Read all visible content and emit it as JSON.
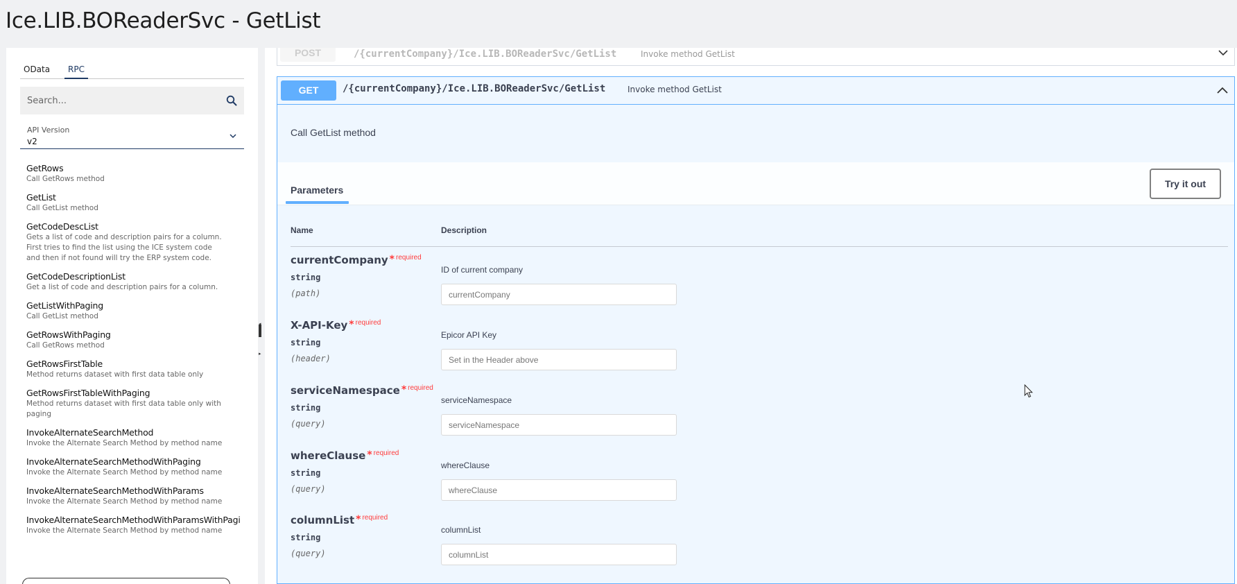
{
  "page": {
    "title": "Ice.LIB.BOReaderSvc - GetList"
  },
  "sidebar": {
    "tabs": [
      {
        "label": "OData"
      },
      {
        "label": "RPC"
      }
    ],
    "search": {
      "placeholder": "Search..."
    },
    "api_version": {
      "label": "API Version",
      "value": "v2"
    },
    "methods": [
      {
        "name": "GetRows",
        "description": "Call GetRows method"
      },
      {
        "name": "GetList",
        "description": "Call GetList method"
      },
      {
        "name": "GetCodeDescList",
        "description": "Gets a list of code and description pairs for a column. First tries to find the list using the ICE system code and then if not found will try the ERP system code."
      },
      {
        "name": "GetCodeDescriptionList",
        "description": "Get a list of code and description pairs for a column."
      },
      {
        "name": "GetListWithPaging",
        "description": "Call GetList method"
      },
      {
        "name": "GetRowsWithPaging",
        "description": "Call GetRows method"
      },
      {
        "name": "GetRowsFirstTable",
        "description": "Method returns dataset with first data table only"
      },
      {
        "name": "GetRowsFirstTableWithPaging",
        "description": "Method returns dataset with first data table only with paging"
      },
      {
        "name": "InvokeAlternateSearchMethod",
        "description": "Invoke the Alternate Search Method by method name"
      },
      {
        "name": "InvokeAlternateSearchMethodWithPaging",
        "description": "Invoke the Alternate Search Method by method name"
      },
      {
        "name": "InvokeAlternateSearchMethodWithParams",
        "description": "Invoke the Alternate Search Method by method name"
      },
      {
        "name": "InvokeAlternateSearchMethodWithParamsWithPagi",
        "description": "Invoke the Alternate Search Method by method name"
      }
    ]
  },
  "operations": {
    "post": {
      "method": "POST",
      "path": "/{currentCompany}/Ice.LIB.BOReaderSvc/GetList",
      "summary": "Invoke method GetList"
    },
    "get": {
      "method": "GET",
      "path": "/{currentCompany}/Ice.LIB.BOReaderSvc/GetList",
      "summary": "Invoke method GetList",
      "description": "Call GetList method",
      "parameters_tab": "Parameters",
      "try_button": "Try it out",
      "columns": {
        "name": "Name",
        "description": "Description"
      },
      "required_label": "required",
      "required_star": "*",
      "params": [
        {
          "name": "currentCompany",
          "type": "string",
          "in": "(path)",
          "description": "ID of current company",
          "placeholder": "currentCompany"
        },
        {
          "name": "X-API-Key",
          "type": "string",
          "in": "(header)",
          "description": "Epicor API Key",
          "placeholder": "Set in the Header above"
        },
        {
          "name": "serviceNamespace",
          "type": "string",
          "in": "(query)",
          "description": "serviceNamespace",
          "placeholder": "serviceNamespace"
        },
        {
          "name": "whereClause",
          "type": "string",
          "in": "(query)",
          "description": "whereClause",
          "placeholder": "whereClause"
        },
        {
          "name": "columnList",
          "type": "string",
          "in": "(query)",
          "description": "columnList",
          "placeholder": "columnList"
        }
      ]
    }
  },
  "colors": {
    "get_accent": "#61affe",
    "get_background": "#eff7ff",
    "required": "#ff3b3b",
    "active_tab": "#1f3a64"
  },
  "icons": {
    "search": "search-icon",
    "api_version_toggle": "chevron-down-icon",
    "post_toggle": "chevron-down-icon",
    "get_toggle": "chevron-up-icon",
    "mouse_cursor": "mouse-pointer-icon"
  }
}
